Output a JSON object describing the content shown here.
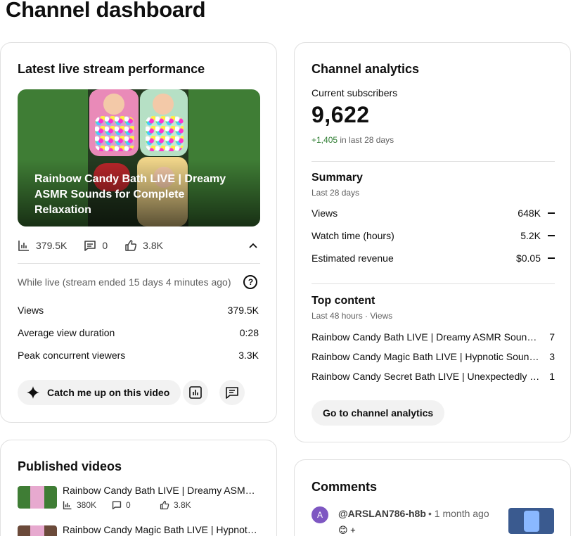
{
  "page": {
    "title": "Channel dashboard"
  },
  "live": {
    "card_title": "Latest live stream performance",
    "video_title": "Rainbow Candy Bath LIVE | Dreamy ASMR Sounds for Complete Relaxation",
    "views_short": "379.5K",
    "comments": "0",
    "likes": "3.8K",
    "while_live": "While live (stream ended 15 days 4 minutes ago)",
    "help_glyph": "?",
    "metrics": [
      {
        "label": "Views",
        "value": "379.5K"
      },
      {
        "label": "Average view duration",
        "value": "0:28"
      },
      {
        "label": "Peak concurrent viewers",
        "value": "3.3K"
      }
    ],
    "catch_up_label": "Catch me up on this video"
  },
  "analytics": {
    "card_title": "Channel analytics",
    "subscribers_label": "Current subscribers",
    "subscribers": "9,622",
    "change_value": "+1,405",
    "change_period": "in last 28 days",
    "summary_title": "Summary",
    "summary_period": "Last 28 days",
    "summary": [
      {
        "label": "Views",
        "value": "648K"
      },
      {
        "label": "Watch time (hours)",
        "value": "5.2K"
      },
      {
        "label": "Estimated revenue",
        "value": "$0.05"
      }
    ],
    "top_title": "Top content",
    "top_period": "Last 48 hours · Views",
    "top": [
      {
        "title": "Rainbow Candy Bath LIVE | Dreamy ASMR Sounds for Complete Relaxation",
        "value": "7"
      },
      {
        "title": "Rainbow Candy Magic Bath LIVE | Hypnotic Sounds for Deep Relaxation",
        "value": "3"
      },
      {
        "title": "Rainbow Candy Secret Bath LIVE | Unexpectedly Satisfying ASMR",
        "value": "1"
      }
    ],
    "go_label": "Go to channel analytics"
  },
  "published": {
    "card_title": "Published videos",
    "videos": [
      {
        "title": "Rainbow Candy Bath LIVE | Dreamy ASMR Sounds for Complete Relaxation",
        "views": "380K",
        "comments": "0",
        "likes": "3.8K"
      },
      {
        "title": "Rainbow Candy Magic Bath LIVE | Hypnotic Sounds for Deep Relaxation"
      }
    ]
  },
  "comments": {
    "card_title": "Comments",
    "items": [
      {
        "avatar_letter": "A",
        "author": "@ARSLAN786-h8b",
        "time": "• 1 month ago",
        "text": "😊 +"
      }
    ]
  },
  "colors": {
    "positive": "#2e7d32",
    "avatar": "#7e57c2",
    "pill_bg": "#f2f2f2"
  }
}
